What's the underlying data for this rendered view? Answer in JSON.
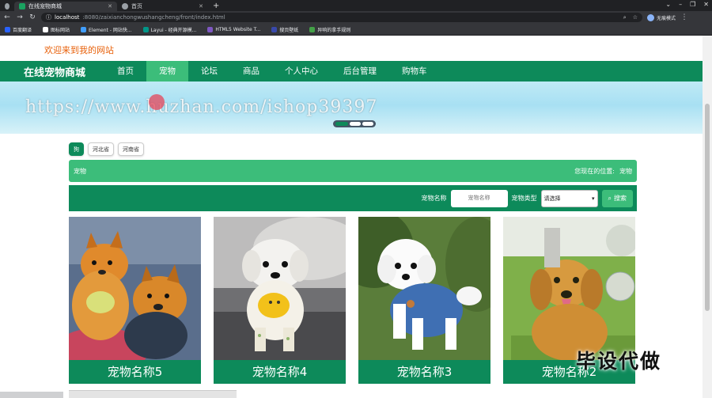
{
  "browser": {
    "tabs": [
      {
        "title": "在线宠物商城",
        "favicon_color": "#1aa260"
      },
      {
        "title": "首页",
        "favicon_color": "#9aa0a6"
      }
    ],
    "url_host": "localhost",
    "url_path": ":8080/zaixianchongwushangcheng/front/index.html",
    "profile_label": "无痕模式",
    "bookmarks": [
      {
        "label": "百度翻译",
        "color": "#2962ff"
      },
      {
        "label": "图标网站",
        "color": "#ffffff"
      },
      {
        "label": "Element - 网站快...",
        "color": "#409eff"
      },
      {
        "label": "Layui - 经典开源模...",
        "color": "#009688"
      },
      {
        "label": "HTML5 Website T...",
        "color": "#7e57c2"
      },
      {
        "label": "搜页壁纸",
        "color": "#3949ab"
      },
      {
        "label": "异响的拿手规则",
        "color": "#43a047"
      }
    ]
  },
  "site": {
    "welcome": "欢迎来到我的网站",
    "brand": "在线宠物商城",
    "nav": [
      "首页",
      "宠物",
      "论坛",
      "商品",
      "个人中心",
      "后台管理",
      "购物车"
    ],
    "active_nav_index": 1,
    "banner_watermark": "https://www.huzhan.com/ishop39397",
    "categories": [
      "狗",
      "河北省",
      "河南省"
    ],
    "breadcrumb_left": "宠物",
    "breadcrumb_prefix": "您现在的位置:",
    "breadcrumb_current": "宠物",
    "search": {
      "name_label": "宠物名称",
      "name_placeholder": "宠物名称",
      "type_label": "宠物类型",
      "type_selected": "请选择",
      "button_label": "搜索"
    },
    "cards": [
      {
        "name": "宠物名称5",
        "theme": "pomeranian"
      },
      {
        "name": "宠物名称4",
        "theme": "maltese"
      },
      {
        "name": "宠物名称3",
        "theme": "bichon"
      },
      {
        "name": "宠物名称2",
        "theme": "golden"
      }
    ],
    "corner_watermark": "毕设代做"
  }
}
